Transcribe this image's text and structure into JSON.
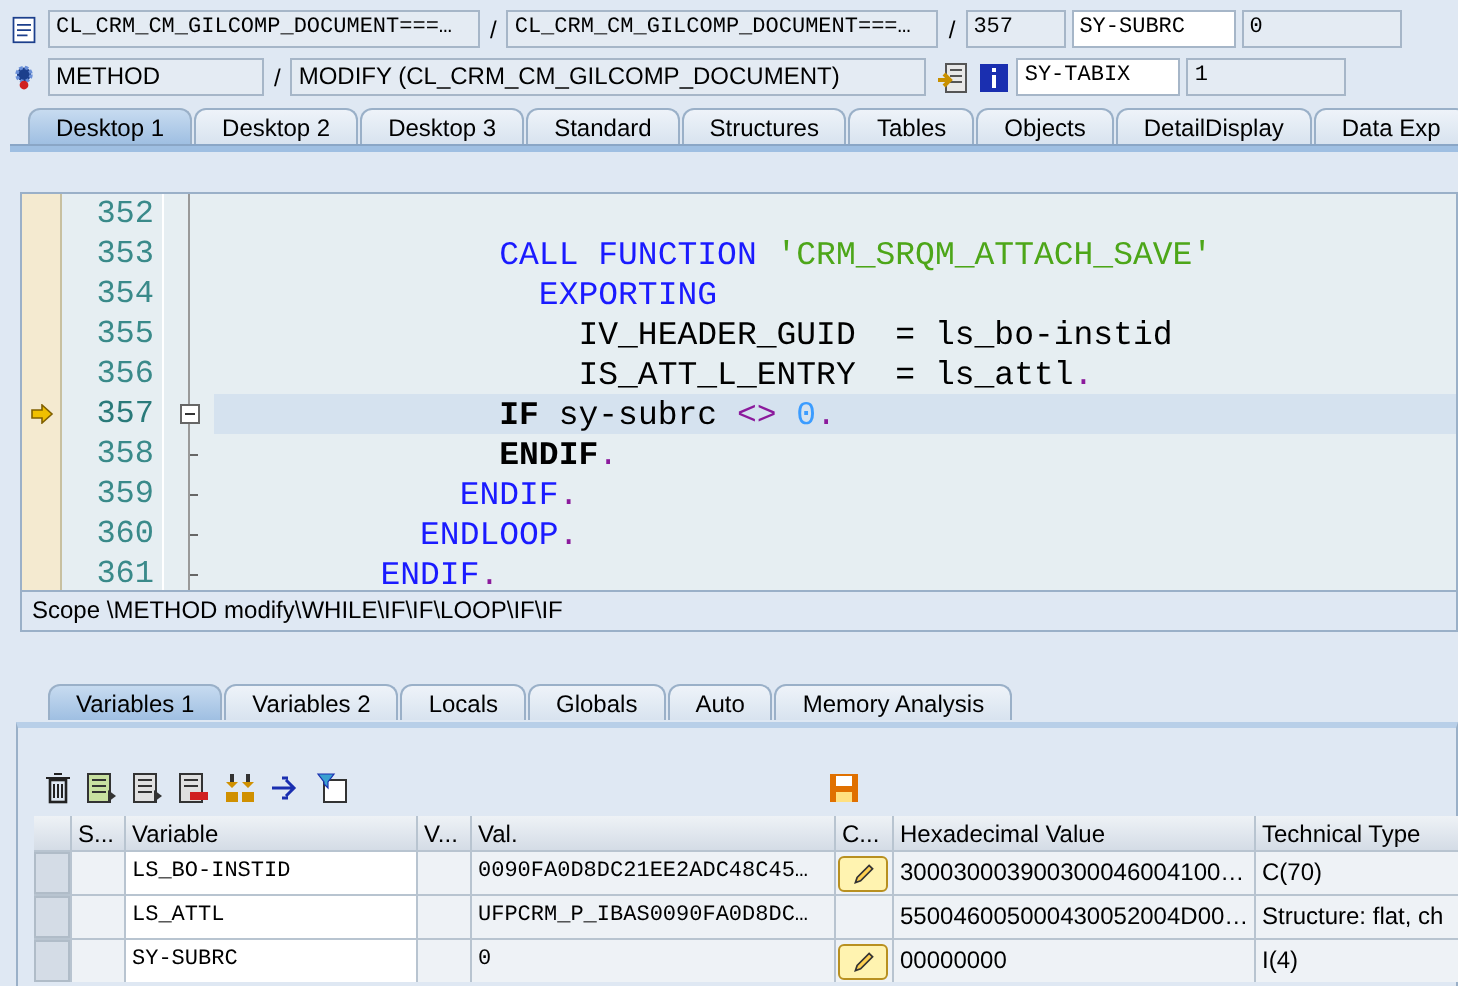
{
  "header": {
    "row1": {
      "program": "CL_CRM_CM_GILCOMP_DOCUMENT===…",
      "separator_1": "/",
      "include": "CL_CRM_CM_GILCOMP_DOCUMENT===…",
      "separator_2": "/",
      "line": "357",
      "sysfield": "SY-SUBRC",
      "sysvalue": "0"
    },
    "row2": {
      "type": "METHOD",
      "separator": "/",
      "event": "MODIFY (CL_CRM_CM_GILCOMP_DOCUMENT)",
      "sysfield": "SY-TABIX",
      "sysvalue": "1"
    }
  },
  "desktop_tabs": [
    {
      "label": "Desktop 1",
      "selected": true
    },
    {
      "label": "Desktop 2",
      "selected": false
    },
    {
      "label": "Desktop 3",
      "selected": false
    },
    {
      "label": "Standard",
      "selected": false
    },
    {
      "label": "Structures",
      "selected": false
    },
    {
      "label": "Tables",
      "selected": false
    },
    {
      "label": "Objects",
      "selected": false
    },
    {
      "label": "DetailDisplay",
      "selected": false
    },
    {
      "label": "Data Exp",
      "selected": false
    }
  ],
  "editor": {
    "lines": [
      {
        "number": "352",
        "current": false,
        "kind": "plain"
      },
      {
        "number": "353",
        "current": false,
        "kind": "plain",
        "tokens": [
          {
            "kind": "keyword",
            "text": "              CALL FUNCTION "
          },
          {
            "kind": "string",
            "text": "'CRM_SRQM_ATTACH_SAVE'"
          }
        ]
      },
      {
        "number": "354",
        "current": false,
        "kind": "plain",
        "tokens": [
          {
            "kind": "keyword",
            "text": "                EXPORTING"
          }
        ]
      },
      {
        "number": "355",
        "current": false,
        "kind": "plain",
        "tokens": [
          {
            "kind": "plain",
            "text": "                  IV_HEADER_GUID  = ls_bo-instid"
          }
        ]
      },
      {
        "number": "356",
        "current": false,
        "kind": "plain",
        "tokens": [
          {
            "kind": "plain",
            "text": "                  IS_ATT_L_ENTRY  = ls_attl"
          },
          {
            "kind": "dot",
            "text": "."
          }
        ]
      },
      {
        "number": "357",
        "current": true,
        "kind": "block_start",
        "tokens": [
          {
            "kind": "bold",
            "text": "              IF"
          },
          {
            "kind": "plain",
            "text": " sy-subrc "
          },
          {
            "kind": "operator",
            "text": "<>"
          },
          {
            "kind": "number",
            "text": " 0"
          },
          {
            "kind": "dot",
            "text": "."
          }
        ]
      },
      {
        "number": "358",
        "current": false,
        "kind": "block_end",
        "tokens": [
          {
            "kind": "bold",
            "text": "              ENDIF"
          },
          {
            "kind": "dot",
            "text": "."
          }
        ]
      },
      {
        "number": "359",
        "current": false,
        "kind": "block_end",
        "tokens": [
          {
            "kind": "keyword",
            "text": "            ENDIF"
          },
          {
            "kind": "dot",
            "text": "."
          }
        ]
      },
      {
        "number": "360",
        "current": false,
        "kind": "block_end",
        "tokens": [
          {
            "kind": "keyword",
            "text": "          ENDLOOP"
          },
          {
            "kind": "dot",
            "text": "."
          }
        ]
      },
      {
        "number": "361",
        "current": false,
        "kind": "block_end",
        "tokens": [
          {
            "kind": "keyword",
            "text": "        ENDIF"
          },
          {
            "kind": "dot",
            "text": "."
          }
        ]
      }
    ],
    "scope": "Scope \\METHOD modify\\WHILE\\IF\\IF\\LOOP\\IF\\IF"
  },
  "variable_tabs": [
    {
      "label": "Variables 1",
      "selected": true
    },
    {
      "label": "Variables 2",
      "selected": false
    },
    {
      "label": "Locals",
      "selected": false
    },
    {
      "label": "Globals",
      "selected": false
    },
    {
      "label": "Auto",
      "selected": false
    },
    {
      "label": "Memory Analysis",
      "selected": false
    }
  ],
  "table": {
    "columns": [
      "S...",
      "Variable",
      "V...",
      "Val.",
      "C...",
      "Hexadecimal Value",
      "Technical Type"
    ],
    "rows": [
      {
        "variable": "LS_BO-INSTID",
        "value": "0090FA0D8DC21EE2ADC48C45…",
        "editable": true,
        "hex": "300030003900300046004100…",
        "type": "C(70)"
      },
      {
        "variable": "LS_ATTL",
        "value": "UFPCRM_P_IBAS0090FA0D8DC…",
        "editable": false,
        "hex": "550046005000430052004D00…",
        "type": "Structure: flat, ch"
      },
      {
        "variable": "SY-SUBRC",
        "value": "0",
        "editable": true,
        "hex": "00000000",
        "type": "I(4)"
      }
    ]
  }
}
